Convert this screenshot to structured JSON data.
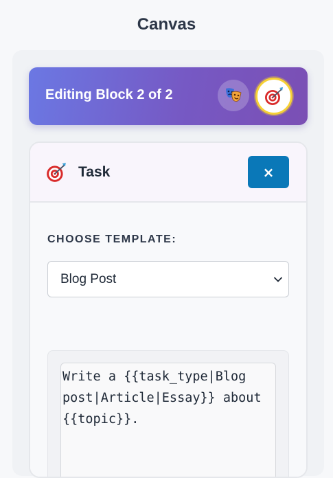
{
  "page": {
    "title": "Canvas"
  },
  "editing_banner": {
    "title": "Editing Block 2 of 2",
    "blocks": [
      {
        "icon": "theater-masks-icon"
      },
      {
        "icon": "target-icon",
        "active": true
      }
    ],
    "gradient_start": "#6b78e3",
    "gradient_end": "#7b4fb4",
    "active_ring_color": "#f6d135"
  },
  "task_card": {
    "title": "Task",
    "icon": "target-icon",
    "close_label": "×",
    "close_button_color": "#0a78b8",
    "template": {
      "label": "CHOOSE TEMPLATE:",
      "selected": "Blog Post"
    },
    "prompt_text": "Write a {{task_type|Blog post|Article|Essay}} about {{topic}}."
  }
}
